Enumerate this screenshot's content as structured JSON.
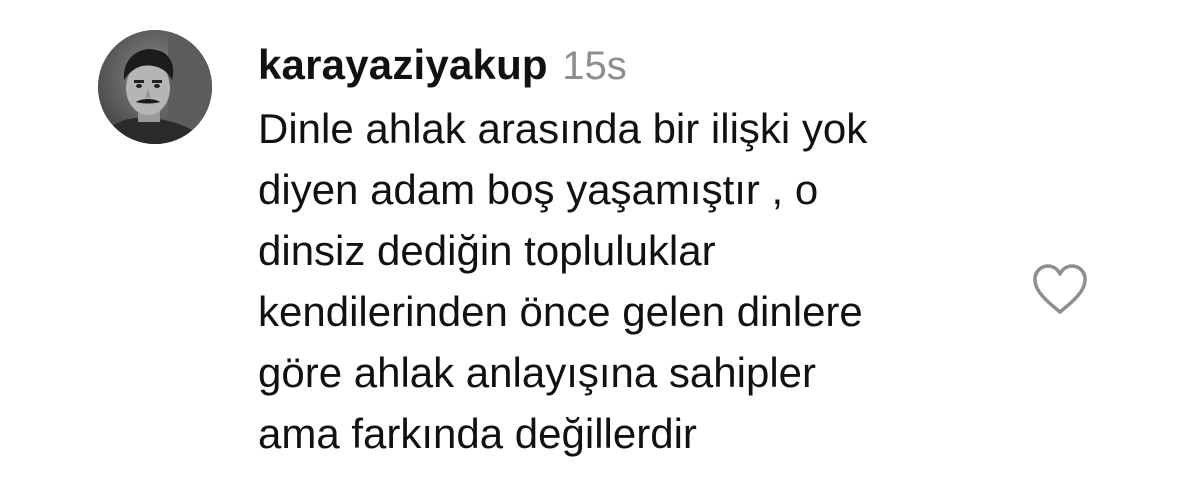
{
  "comment": {
    "author": {
      "username": "karayaziyakup",
      "timestamp": "15s",
      "avatar_icon": "profile-photo-avatar"
    },
    "text_lines": [
      "Dinle ahlak arasında bir ilişki yok",
      "diyen adam boş yaşamıştır , o",
      "dinsiz dediğin topluluklar",
      "kendilerinden önce gelen dinlere",
      "göre ahlak anlayışına sahipler",
      "ama farkında değillerdir"
    ],
    "like_icon": "heart-outline-icon"
  },
  "colors": {
    "text": "#111111",
    "timestamp": "#8e8e8e",
    "icon_stroke": "#8e8e8e",
    "background": "#ffffff"
  }
}
